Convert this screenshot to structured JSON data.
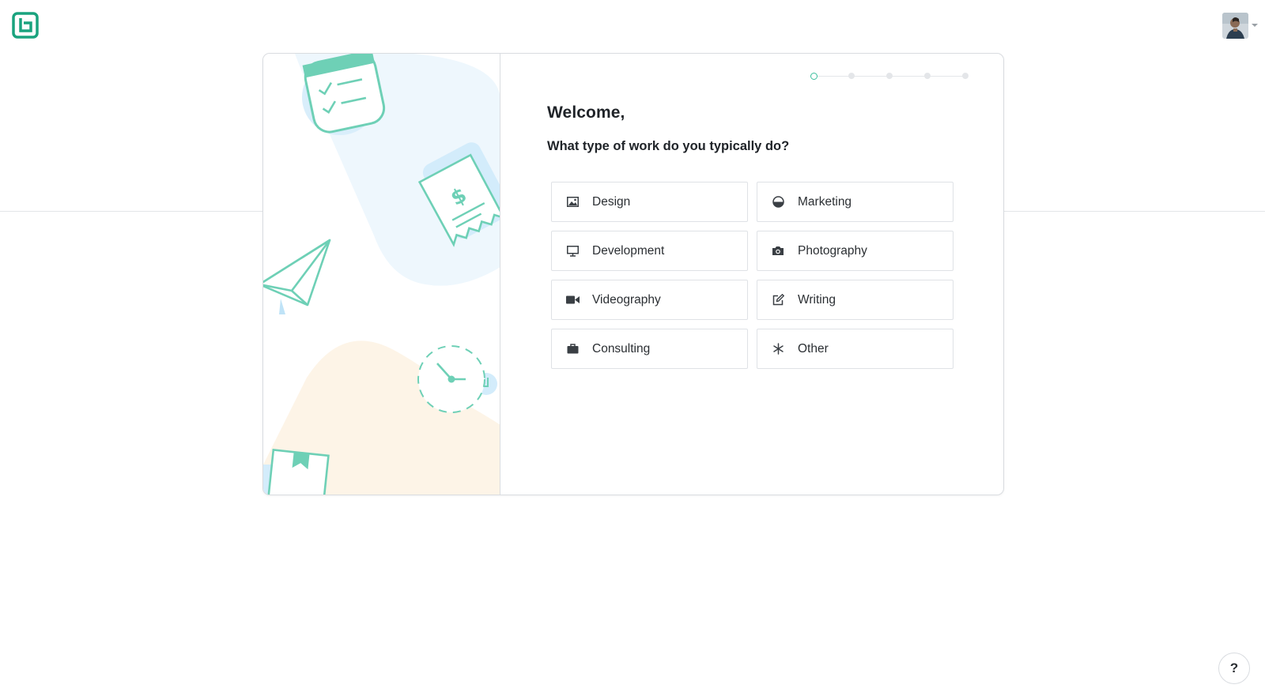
{
  "header": {
    "logo_icon": "bonsai-logo-icon",
    "brand_color": "#1aa37e",
    "avatar_icon": "user-avatar-icon",
    "avatar_menu_icon": "chevron-down-icon"
  },
  "onboarding": {
    "steps_total": 5,
    "current_step": 1,
    "title": "Welcome,",
    "question": "What type of work do you typically do?",
    "options": [
      {
        "label": "Design",
        "icon": "image-icon"
      },
      {
        "label": "Marketing",
        "icon": "pie-icon"
      },
      {
        "label": "Development",
        "icon": "monitor-icon"
      },
      {
        "label": "Photography",
        "icon": "camera-icon"
      },
      {
        "label": "Videography",
        "icon": "video-camera-icon"
      },
      {
        "label": "Writing",
        "icon": "edit-icon"
      },
      {
        "label": "Consulting",
        "icon": "briefcase-icon"
      },
      {
        "label": "Other",
        "icon": "asterisk-icon"
      }
    ]
  },
  "help": {
    "label": "?"
  },
  "colors": {
    "accent": "#3bbf9e",
    "illustration_blue": "#eaf5fd",
    "illustration_peach": "#fdf3e6",
    "illustration_green": "#7fd4bd"
  }
}
